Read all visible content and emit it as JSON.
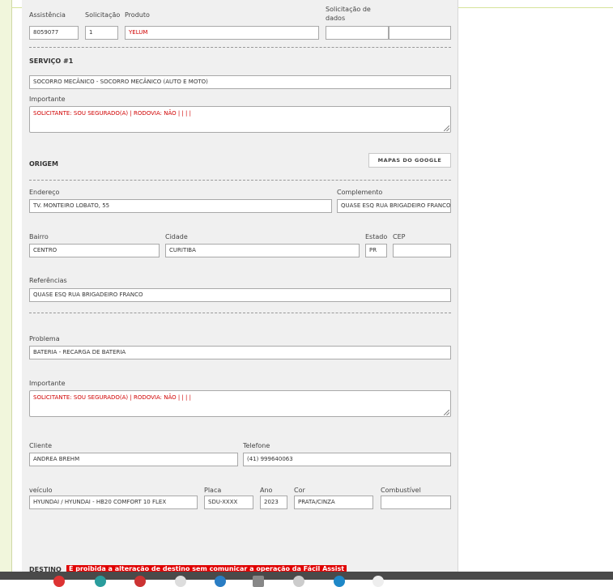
{
  "header": {
    "assistencia_label": "Assistência",
    "assistencia_value": "8059077",
    "solicitacao_label": "Solicitação",
    "solicitacao_value": "1",
    "produto_label": "Produto",
    "produto_value": "YELUM",
    "solicitacao_dados_label": "Solicitação de dados",
    "solicitacao_dados_value1": "",
    "solicitacao_dados_value2": ""
  },
  "servico": {
    "title": "SERVIÇO #1",
    "service_value": "SOCORRO MECÂNICO - SOCORRO MECÂNICO (AUTO E MOTO)",
    "importante_label": "Importante",
    "importante_value": "SOLICITANTE: SOU SEGURADO(A) | RODOVIA: NÃO |  |  |  |"
  },
  "origem": {
    "title": "ORIGEM",
    "maps_button": "MAPAS DO GOOGLE",
    "endereco_label": "Endereço",
    "endereco_value": "TV. MONTEIRO LOBATO, 55",
    "complemento_label": "Complemento",
    "complemento_value": "QUASE ESQ RUA BRIGADEIRO FRANCO",
    "bairro_label": "Bairro",
    "bairro_value": "CENTRO",
    "cidade_label": "Cidade",
    "cidade_value": "CURITIBA",
    "estado_label": "Estado",
    "estado_value": "PR",
    "cep_label": "CEP",
    "cep_value": "",
    "referencias_label": "Referências",
    "referencias_value": "QUASE ESQ RUA BRIGADEIRO FRANCO"
  },
  "problema": {
    "problema_label": "Problema",
    "problema_value": "BATERIA - RECARGA DE BATERIA",
    "importante_label": "Importante",
    "importante_value": "SOLICITANTE: SOU SEGURADO(A) | RODOVIA: NÃO |  |  |  |"
  },
  "cliente": {
    "cliente_label": "Cliente",
    "cliente_value": "ANDREA BREHM",
    "telefone_label": "Telefone",
    "telefone_value": "(41) 999640063"
  },
  "veiculo": {
    "veiculo_label": "veículo",
    "veiculo_value": "HYUNDAI / HYUNDAI - HB20 COMFORT 10 FLEX",
    "placa_label": "Placa",
    "placa_value": "SDU-XXXX",
    "ano_label": "Ano",
    "ano_value": "2023",
    "cor_label": "Cor",
    "cor_value": "PRATA/CINZA",
    "combustivel_label": "Combustível",
    "combustivel_value": ""
  },
  "destino": {
    "title": "DESTINO",
    "warning": "É proibida a alteração de destino sem comunicar a operação da Fácil Assist"
  },
  "colors": {
    "accent_red": "#e00000",
    "panel_bg": "#f0f0f0",
    "left_strip": "#f1f6dc"
  }
}
